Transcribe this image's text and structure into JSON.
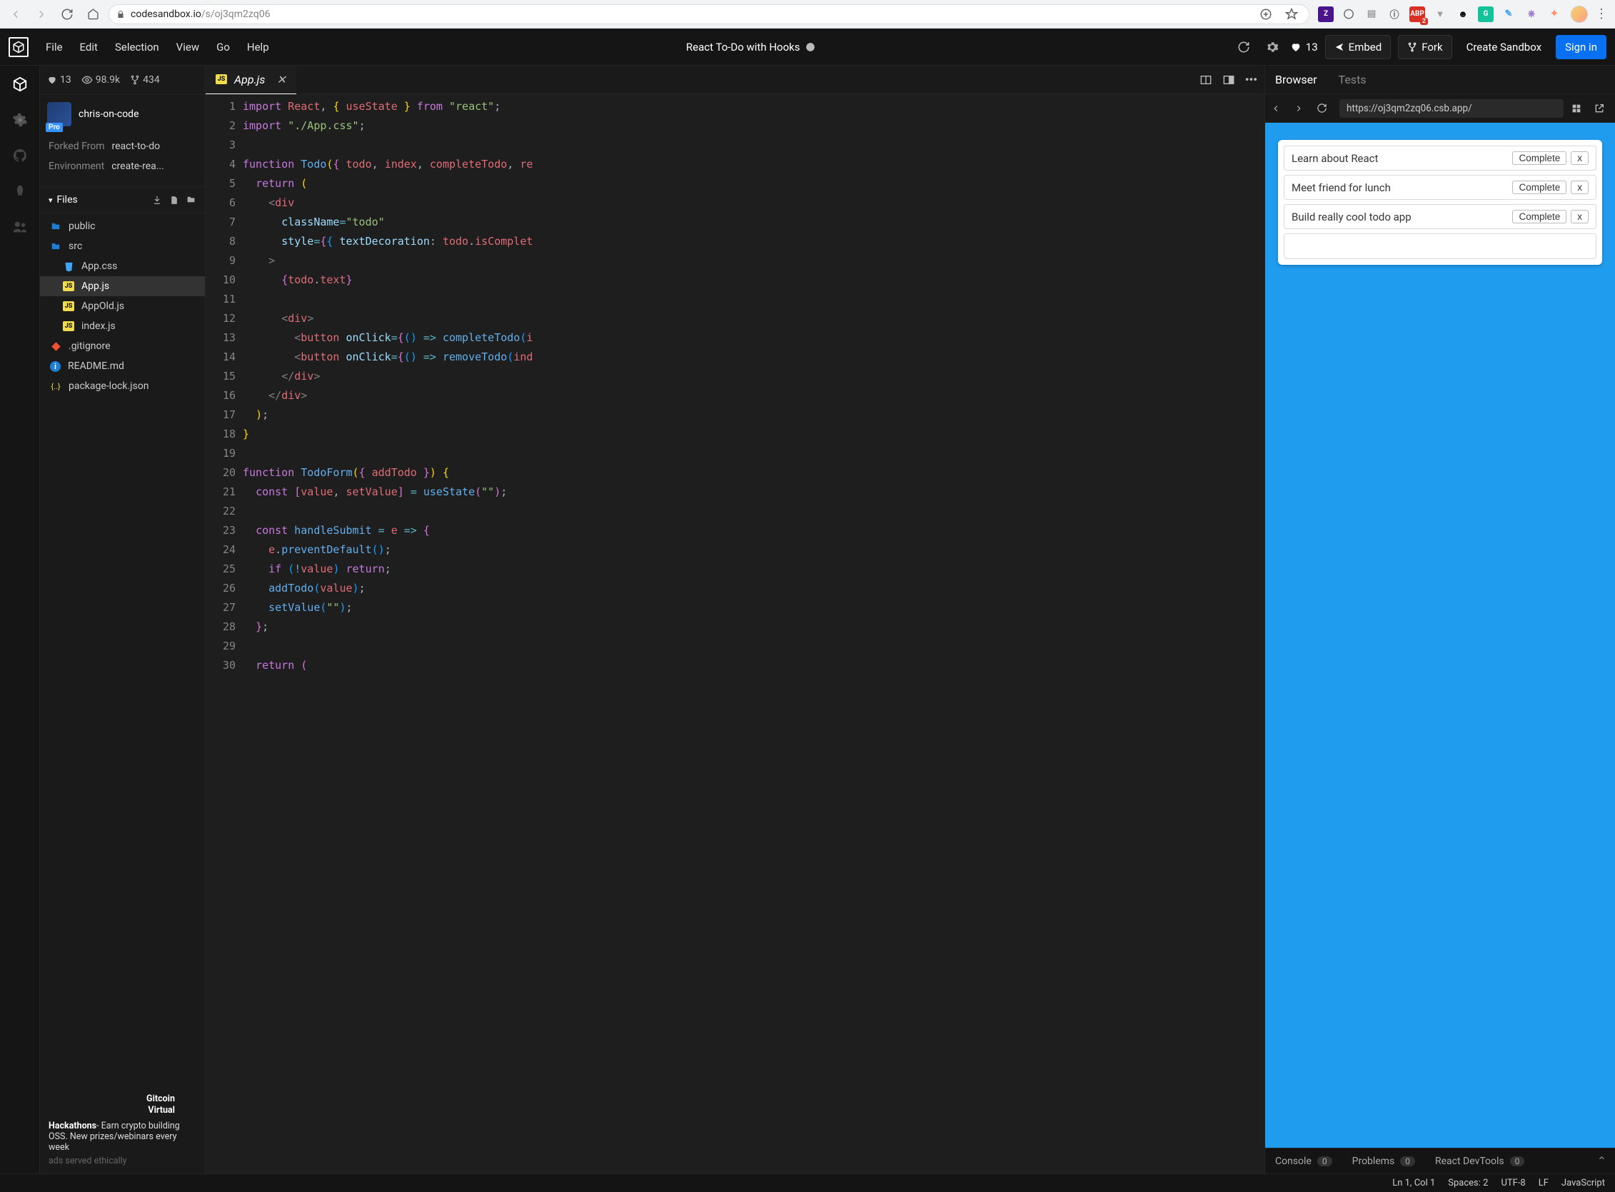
{
  "browser": {
    "url_prefix": "codesandbox.io",
    "url_path": "/s/oj3qm2zq06",
    "extensions": [
      {
        "name": "Z",
        "bg": "#4a148c",
        "fg": "#ffffff",
        "label": "Z"
      },
      {
        "name": "circle",
        "bg": "transparent",
        "fg": "#5f6368",
        "label": "◯"
      },
      {
        "name": "doc",
        "bg": "transparent",
        "fg": "#9aa0a6",
        "label": "▤"
      },
      {
        "name": "info",
        "bg": "transparent",
        "fg": "#5f6368",
        "label": "ⓘ"
      },
      {
        "name": "adblock",
        "bg": "#d93025",
        "fg": "#ffffff",
        "label": "ABP",
        "badge": "2"
      },
      {
        "name": "vue",
        "bg": "transparent",
        "fg": "#9aa0a6",
        "label": "▼"
      },
      {
        "name": "emoji",
        "bg": "transparent",
        "fg": "#000",
        "label": "☻"
      },
      {
        "name": "grammarly",
        "bg": "#15c39a",
        "fg": "#ffffff",
        "label": "G"
      },
      {
        "name": "quill",
        "bg": "transparent",
        "fg": "#42a5f5",
        "label": "✎"
      },
      {
        "name": "octo",
        "bg": "transparent",
        "fg": "#9575cd",
        "label": "⎈"
      },
      {
        "name": "mask",
        "bg": "transparent",
        "fg": "#ff8a65",
        "label": "✦"
      }
    ]
  },
  "menubar": {
    "items": [
      "File",
      "Edit",
      "Selection",
      "View",
      "Go",
      "Help"
    ],
    "title": "React To-Do with Hooks",
    "likes": "13",
    "embed": "Embed",
    "fork": "Fork",
    "create": "Create Sandbox",
    "signin": "Sign in"
  },
  "sidebar": {
    "stats": {
      "likes": "13",
      "views": "98.9k",
      "forks": "434"
    },
    "user": {
      "name": "chris-on-code",
      "badge": "Pro"
    },
    "forked_label": "Forked From",
    "forked_value": "react-to-do",
    "env_label": "Environment",
    "env_value": "create-rea...",
    "files_label": "Files",
    "tree": [
      {
        "kind": "folder",
        "name": "public",
        "indent": 0
      },
      {
        "kind": "folder",
        "name": "src",
        "indent": 0,
        "open": true
      },
      {
        "kind": "css",
        "name": "App.css",
        "indent": 1
      },
      {
        "kind": "js",
        "name": "App.js",
        "indent": 1,
        "active": true
      },
      {
        "kind": "js",
        "name": "AppOld.js",
        "indent": 1
      },
      {
        "kind": "js",
        "name": "index.js",
        "indent": 1
      },
      {
        "kind": "git",
        "name": ".gitignore",
        "indent": 0
      },
      {
        "kind": "info",
        "name": "README.md",
        "indent": 0
      },
      {
        "kind": "json",
        "name": "package-lock.json",
        "indent": 0
      }
    ],
    "ad": {
      "title_line1": "Gitcoin",
      "title_line2": "Virtual",
      "body": "Hackathons- Earn crypto building OSS. New prizes/webinars every week",
      "ethics": "ads served ethically"
    }
  },
  "editor": {
    "tab_filename": "App.js",
    "lines": 30
  },
  "preview": {
    "tabs": {
      "browser": "Browser",
      "tests": "Tests"
    },
    "url": "https://oj3qm2zq06.csb.app/",
    "todos": [
      {
        "text": "Learn about React",
        "complete": "Complete",
        "x": "x"
      },
      {
        "text": "Meet friend for lunch",
        "complete": "Complete",
        "x": "x"
      },
      {
        "text": "Build really cool todo app",
        "complete": "Complete",
        "x": "x"
      }
    ],
    "console": {
      "console_label": "Console",
      "console_n": "0",
      "problems_label": "Problems",
      "problems_n": "0",
      "devtools_label": "React DevTools",
      "devtools_n": "0"
    }
  },
  "status": {
    "pos": "Ln 1, Col 1",
    "spaces": "Spaces: 2",
    "encoding": "UTF-8",
    "eol": "LF",
    "lang": "JavaScript"
  }
}
